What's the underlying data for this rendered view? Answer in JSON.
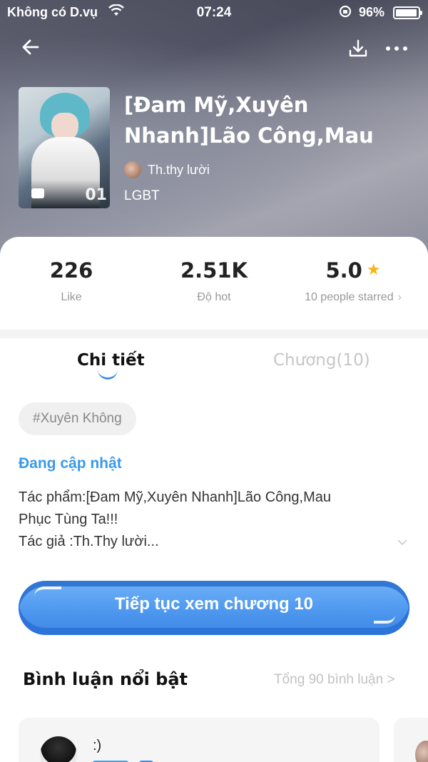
{
  "status_bar": {
    "carrier": "Không có D.vụ",
    "time": "07:24",
    "battery_percent": "96%"
  },
  "nav": {
    "back_icon": "back-arrow-icon",
    "download_icon": "download-icon",
    "more_icon": "more-dots-icon"
  },
  "book": {
    "title": "[Đam Mỹ,Xuyên Nhanh]Lão Công,Mau",
    "author": "Th.thy lười",
    "genre": "LGBT",
    "cover_number": "01"
  },
  "stats": {
    "likes_value": "226",
    "likes_label": "Like",
    "hot_value": "2.51K",
    "hot_label": "Độ hot",
    "rating_value": "5.0",
    "rating_label": "10 people starred",
    "rating_chevron": "›"
  },
  "tabs": {
    "details": "Chi tiết",
    "chapters": "Chương(10)"
  },
  "tag": "#Xuyên Không",
  "update_status": "Đang cập nhật",
  "description": {
    "line1": "Tác phẩm:[Đam Mỹ,Xuyên Nhanh]Lão Công,Mau",
    "line2": "Phục Tùng Ta!!!",
    "line3": "Tác giả :Th.Thy lười..."
  },
  "continue_button": "Tiếp tục xem chương 10",
  "comments": {
    "title": "Bình luận nổi bật",
    "count_link": "Tổng 90 bình luận >",
    "first_comment_text": ":)"
  },
  "colors": {
    "accent": "#3a9ae8",
    "star": "#f5b518"
  }
}
